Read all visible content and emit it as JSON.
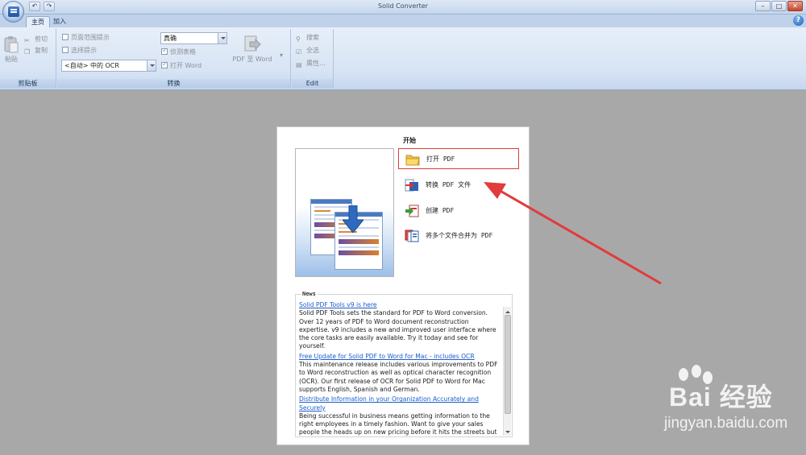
{
  "window": {
    "title": "Solid Converter",
    "buttons": {
      "minimize": "–",
      "maximize": "□",
      "close": "✕"
    }
  },
  "tabs": [
    {
      "label": "主页",
      "active": true
    },
    {
      "label": "加入",
      "active": false
    }
  ],
  "help_label": "?",
  "ribbon": {
    "clipboard": {
      "paste_label": "粘贴",
      "cut_label": "剪切",
      "copy_label": "复制",
      "group_label": "剪贴板"
    },
    "convert": {
      "page_range_label": "页面范围提示",
      "selection_label": "选择提示",
      "ocr_select_value": "<自动> 中的 OCR",
      "mode_select_value": "真确",
      "detect_tables_label": "侦测表格",
      "open_word_label": "打开 Word",
      "pdf_to_word_label": "PDF 至 Word",
      "group_label": "转换"
    },
    "edit": {
      "search_label": "搜索",
      "select_all_label": "全选",
      "properties_label": "属性...",
      "group_label": "Edit"
    }
  },
  "start_panel": {
    "title": "开始",
    "actions": [
      {
        "label": "打开 PDF",
        "icon": "folder-icon",
        "highlighted": true
      },
      {
        "label": "转换 PDF 文件",
        "icon": "convert-icon",
        "highlighted": false
      },
      {
        "label": "创建 PDF",
        "icon": "create-pdf-icon",
        "highlighted": false
      },
      {
        "label": "将多个文件合并为 PDF",
        "icon": "combine-pdf-icon",
        "highlighted": false
      }
    ],
    "news": {
      "title": "News",
      "items": [
        {
          "link": "Solid PDF Tools v9 is here",
          "text": "Solid PDF Tools sets the standard for PDF to Word conversion. Over 12 years of PDF to Word document reconstruction expertise. v9 includes a new and improved user interface where the core tasks are easily available. Try it today and see for yourself."
        },
        {
          "link": "Free Update for Solid PDF to Word for Mac - includes OCR",
          "text": "This maintenance release includes various improvements to PDF to Word reconstruction as well as optical character recognition (OCR). Our first release of OCR for Solid PDF to Word for Mac supports English, Spanish and German."
        },
        {
          "link": "Distribute Information in your Organization Accurately and Securely",
          "text": "Being successful in business means getting information to the right employees in a timely fashion. Want to give your sales people the heads up on new pricing before it hits the streets but"
        }
      ]
    }
  },
  "watermark": {
    "brand": "Bai 经验",
    "url": "jingyan.baidu.com"
  },
  "colors": {
    "annotation_red": "#e23b3b",
    "link_blue": "#1a5dc9",
    "workspace_gray": "#a8a8a8"
  }
}
